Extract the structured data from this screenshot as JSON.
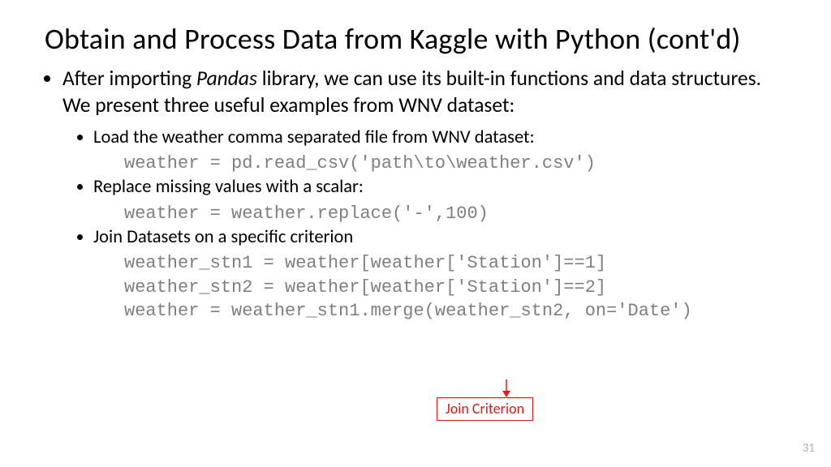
{
  "title": "Obtain and Process Data from Kaggle with Python (cont'd)",
  "bullet": {
    "prefix": "After importing ",
    "italic": "Pandas",
    "suffix": " library, we can use its built-in functions and data structures. We present three useful examples from WNV dataset:"
  },
  "sub": [
    {
      "text": "Load the weather comma separated file from WNV dataset:",
      "code": [
        "weather = pd.read_csv('path\\to\\weather.csv')"
      ]
    },
    {
      "text": "Replace missing values with a scalar:",
      "code": [
        "weather = weather.replace('-',100)"
      ]
    },
    {
      "text": "Join Datasets on a specific criterion",
      "code": [
        "weather_stn1 = weather[weather['Station']==1]",
        "weather_stn2 = weather[weather['Station']==2]",
        "weather = weather_stn1.merge(weather_stn2, on='Date')"
      ]
    }
  ],
  "callout": "Join Criterion",
  "page": "31"
}
